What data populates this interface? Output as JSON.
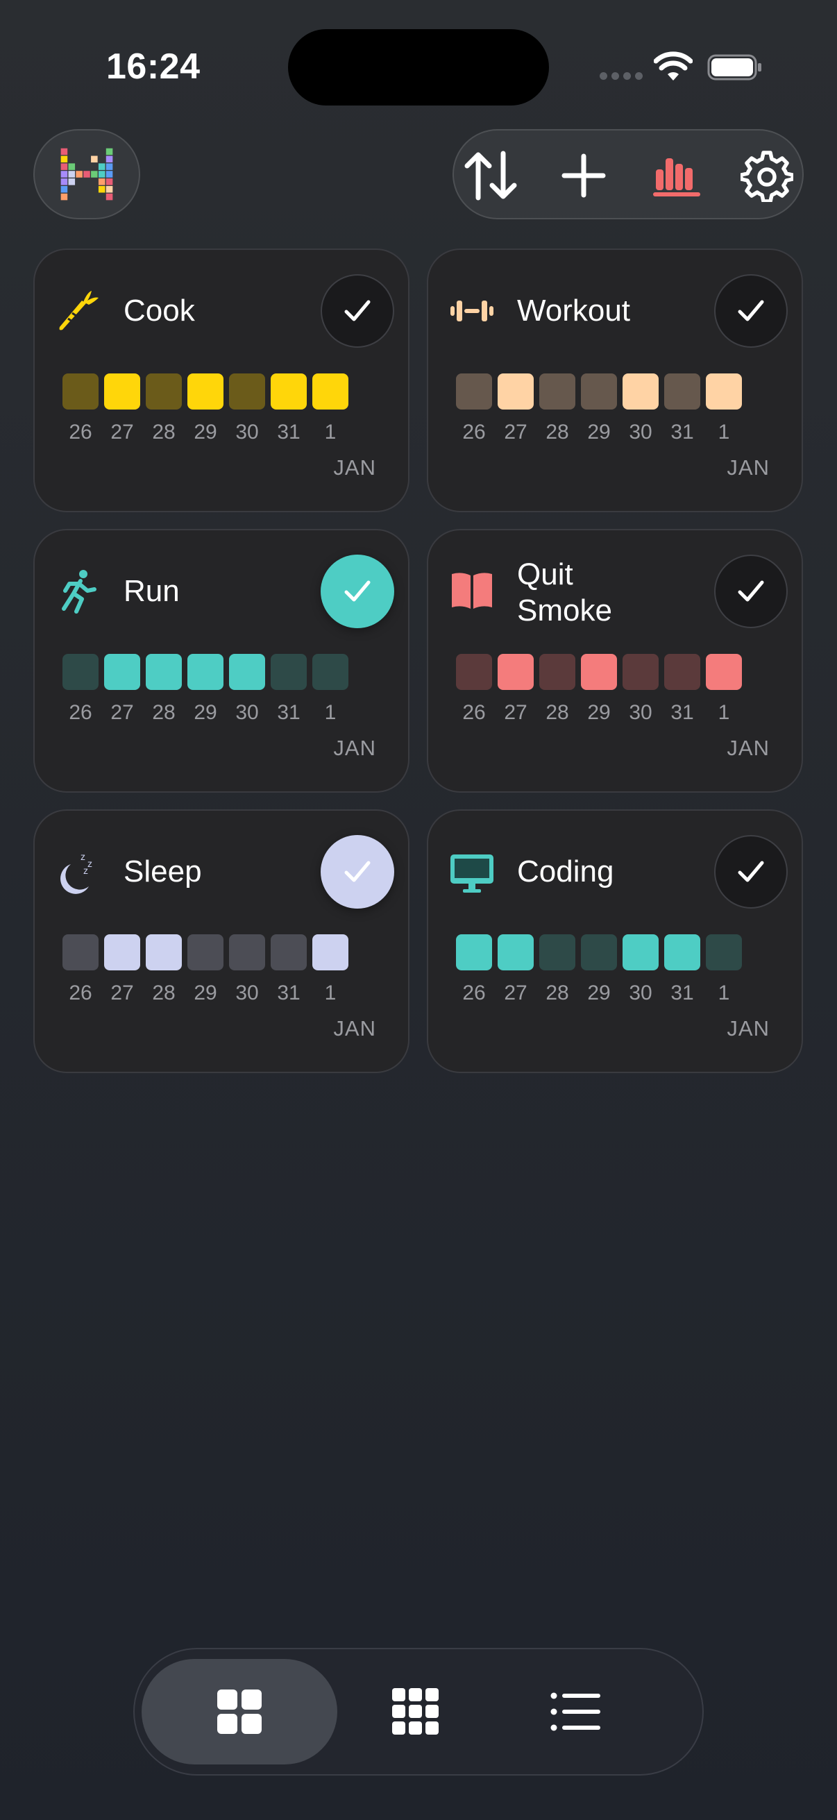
{
  "status_bar": {
    "time": "16:24"
  },
  "header": {
    "logo_icon": "pixel-h-logo",
    "toolbar": [
      {
        "name": "sort",
        "icon": "sort-arrows-icon"
      },
      {
        "name": "add",
        "icon": "plus-icon"
      },
      {
        "name": "stats",
        "icon": "bar-chart-icon"
      },
      {
        "name": "settings",
        "icon": "gear-icon"
      }
    ]
  },
  "days": [
    "26",
    "27",
    "28",
    "29",
    "30",
    "31",
    "1"
  ],
  "habits": [
    {
      "name": "Cook",
      "icon": "carrot-icon",
      "color": "#ffd60a",
      "dim": "#6b5b1a",
      "checked_today": false,
      "completed": [
        false,
        true,
        false,
        true,
        false,
        true,
        true
      ],
      "month": "JAN"
    },
    {
      "name": "Workout",
      "icon": "dumbbell-icon",
      "color": "#ffd3a5",
      "dim": "#66584d",
      "checked_today": false,
      "completed": [
        false,
        true,
        false,
        false,
        true,
        false,
        true
      ],
      "month": "JAN"
    },
    {
      "name": "Run",
      "icon": "running-person-icon",
      "color": "#4ecdc4",
      "dim": "#2e4a48",
      "checked_today": true,
      "completed": [
        false,
        true,
        true,
        true,
        true,
        false,
        false
      ],
      "month": "JAN"
    },
    {
      "name": "Quit Smoke",
      "icon": "open-book-icon",
      "color": "#f47c7c",
      "dim": "#5b3a3b",
      "checked_today": false,
      "completed": [
        false,
        true,
        false,
        true,
        false,
        false,
        true
      ],
      "month": "JAN"
    },
    {
      "name": "Sleep",
      "icon": "moon-zzz-icon",
      "color": "#cdd2f0",
      "dim": "#4c4d55",
      "checked_today": true,
      "completed": [
        false,
        true,
        true,
        false,
        false,
        false,
        true
      ],
      "month": "JAN"
    },
    {
      "name": "Coding",
      "icon": "monitor-icon",
      "color": "#4ecdc4",
      "dim": "#2e4a48",
      "checked_today": false,
      "completed": [
        true,
        true,
        false,
        false,
        true,
        true,
        false
      ],
      "month": "JAN"
    }
  ],
  "tabbar": [
    {
      "name": "grid-large",
      "icon": "grid-2x2-icon",
      "active": true
    },
    {
      "name": "grid-small",
      "icon": "grid-3x3-icon",
      "active": false
    },
    {
      "name": "list",
      "icon": "list-icon",
      "active": false
    }
  ]
}
